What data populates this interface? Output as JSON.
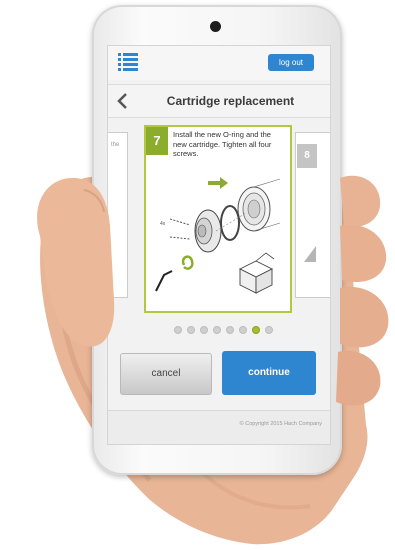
{
  "header": {
    "menu_icon": "hamburger-menu-icon",
    "logout_label": "log out"
  },
  "titlebar": {
    "back_icon": "chevron-left-icon",
    "title": "Cartridge replacement"
  },
  "carousel": {
    "previous_card_text": "the",
    "step": {
      "number": "7",
      "instruction": "Install the new O-ring and the new cartridge. Tighten all four screws."
    },
    "next_step_number": "8",
    "next_icon": "triangle-left-icon",
    "page_count": 8,
    "active_page": 7,
    "accent_color": "#8cac2c"
  },
  "actions": {
    "cancel_label": "cancel",
    "continue_label": "continue",
    "primary_color": "#2f86d0"
  },
  "footer": {
    "copyright": "© Copyright 2015 Hach Company"
  }
}
